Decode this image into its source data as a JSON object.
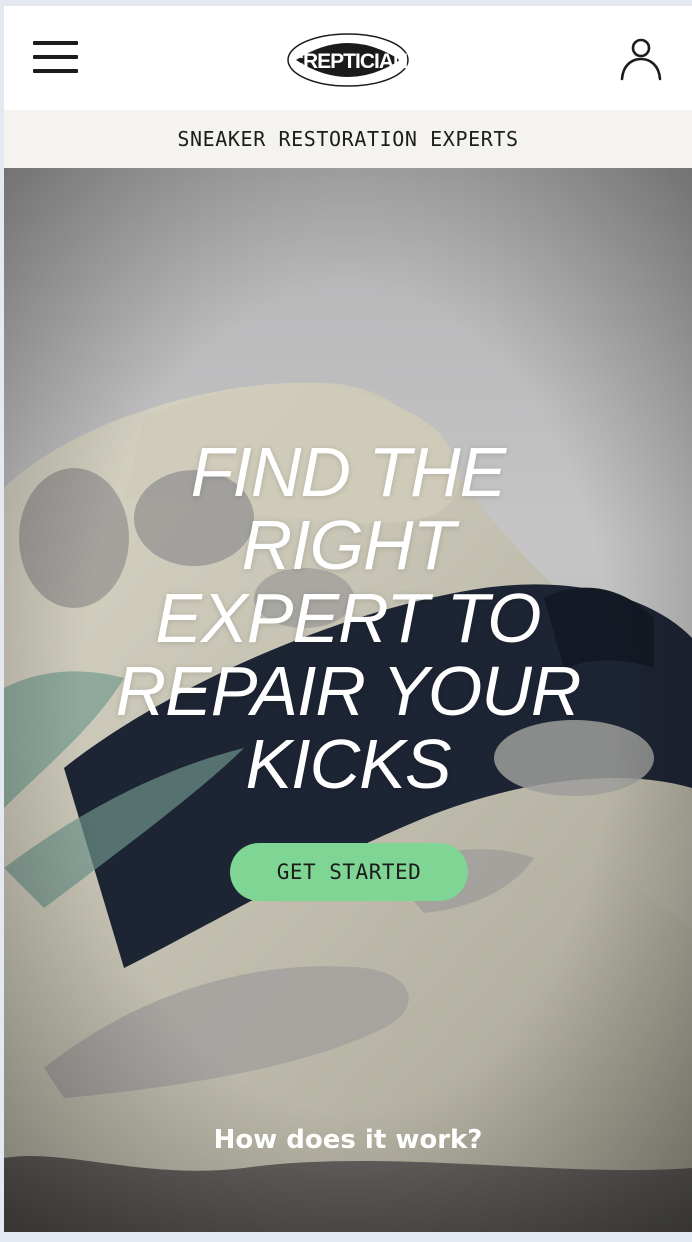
{
  "header": {
    "menu_icon": "hamburger-menu-icon",
    "logo_text": "CREPTICIAN",
    "account_icon": "user-account-icon"
  },
  "banner": {
    "tagline": "SNEAKER RESTORATION EXPERTS"
  },
  "hero": {
    "title": "FIND THE RIGHT EXPERT TO REPAIR YOUR KICKS",
    "cta_label": "GET STARTED",
    "how_link": "How does it work?"
  },
  "colors": {
    "cta_background": "#7fd694",
    "tagline_background": "#f4f3f0",
    "text_dark": "#1c1c1c",
    "hero_text": "#ffffff"
  }
}
